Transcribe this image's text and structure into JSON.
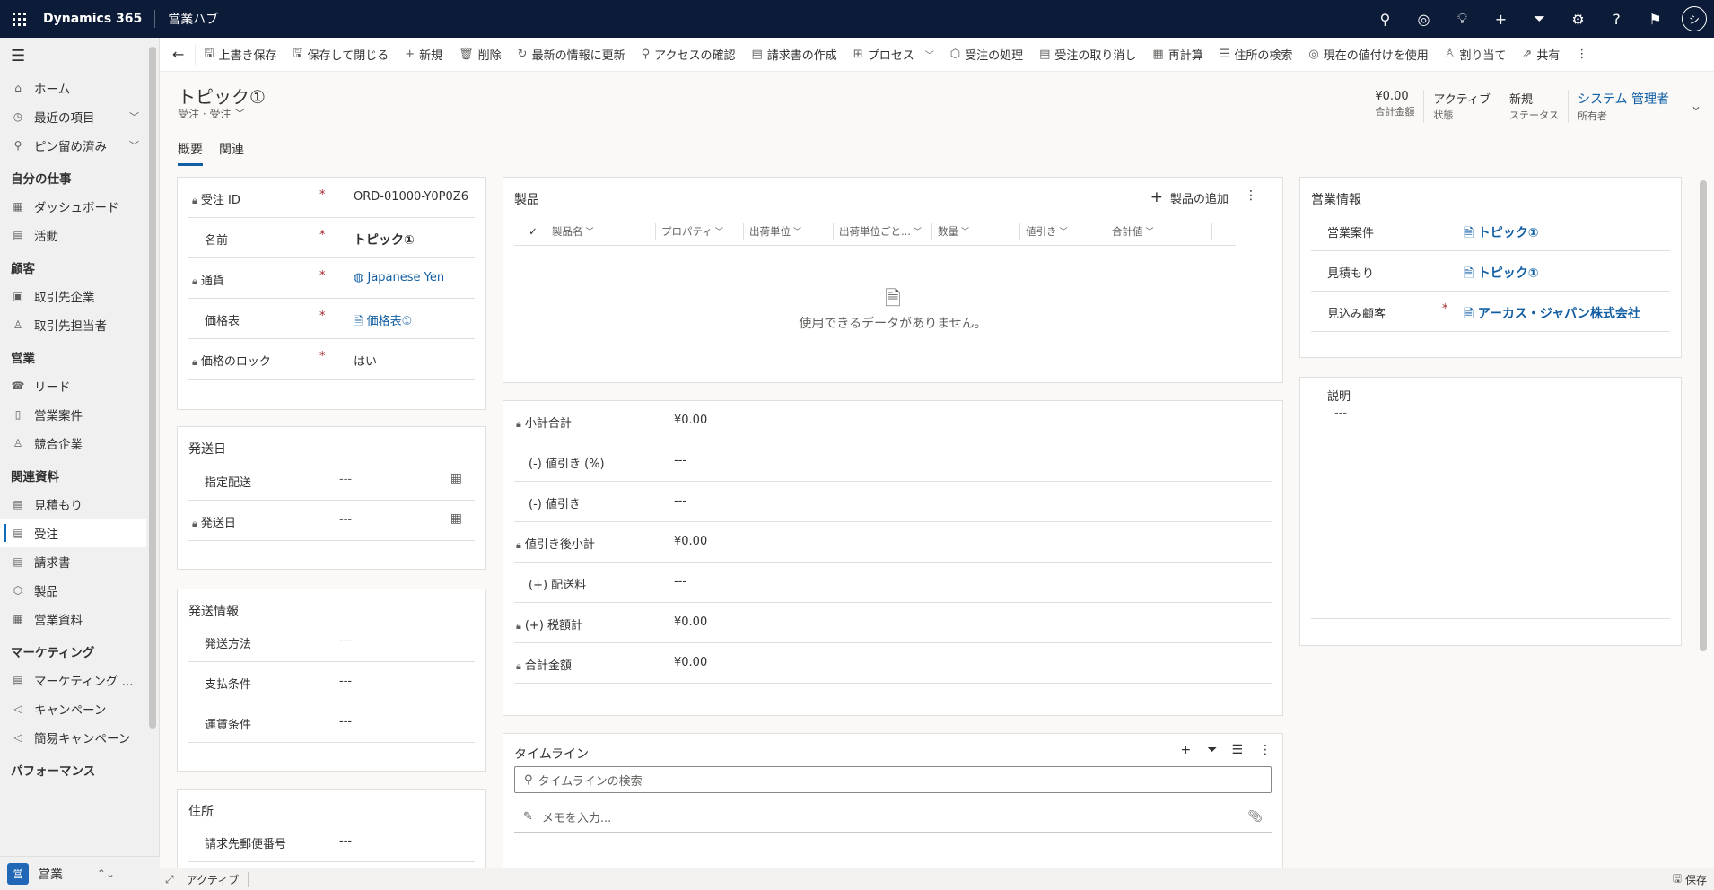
{
  "topbar": {
    "brand": "Dynamics 365",
    "hub": "営業ハブ",
    "icons": [
      "search-icon",
      "task-icon",
      "lightbulb-icon",
      "add-icon",
      "filter-icon",
      "settings-icon",
      "help-icon",
      "feedback-icon"
    ],
    "avatar": "シ"
  },
  "sidebar": {
    "items_top": [
      {
        "icon": "⌂",
        "label": "ホーム"
      },
      {
        "icon": "◷",
        "label": "最近の項目",
        "chev": "﹀"
      },
      {
        "icon": "⚲",
        "label": "ピン留め済み",
        "chev": "﹀"
      }
    ],
    "sections": [
      {
        "title": "自分の仕事",
        "items": [
          {
            "icon": "▦",
            "label": "ダッシュボード"
          },
          {
            "icon": "▤",
            "label": "活動"
          }
        ]
      },
      {
        "title": "顧客",
        "items": [
          {
            "icon": "▣",
            "label": "取引先企業"
          },
          {
            "icon": "♙",
            "label": "取引先担当者"
          }
        ]
      },
      {
        "title": "営業",
        "items": [
          {
            "icon": "☎",
            "label": "リード"
          },
          {
            "icon": "▯",
            "label": "営業案件"
          },
          {
            "icon": "♙",
            "label": "競合企業"
          }
        ]
      },
      {
        "title": "関連資料",
        "items": [
          {
            "icon": "▤",
            "label": "見積もり"
          },
          {
            "icon": "▤",
            "label": "受注"
          },
          {
            "icon": "▤",
            "label": "請求書"
          },
          {
            "icon": "⬡",
            "label": "製品"
          },
          {
            "icon": "▦",
            "label": "営業資料"
          }
        ]
      },
      {
        "title": "マーケティング",
        "items": [
          {
            "icon": "▤",
            "label": "マーケティング ..."
          },
          {
            "icon": "◁",
            "label": "キャンペーン"
          },
          {
            "icon": "◁",
            "label": "簡易キャンペーン"
          }
        ]
      },
      {
        "title": "パフォーマンス",
        "items": []
      }
    ],
    "area": {
      "badge": "営",
      "label": "営業",
      "chev": "⌃⌄"
    }
  },
  "commands": [
    {
      "icon": "🖫",
      "label": "上書き保存"
    },
    {
      "icon": "🖫",
      "label": "保存して閉じる"
    },
    {
      "icon": "+",
      "label": "新規"
    },
    {
      "icon": "🗑",
      "label": "削除"
    },
    {
      "icon": "↻",
      "label": "最新の情報に更新"
    },
    {
      "icon": "⚲",
      "label": "アクセスの確認"
    },
    {
      "icon": "▤",
      "label": "請求書の作成"
    },
    {
      "icon": "⊞",
      "label": "プロセス",
      "dd": "﹀"
    },
    {
      "icon": "⬡",
      "label": "受注の処理"
    },
    {
      "icon": "▤",
      "label": "受注の取り消し"
    },
    {
      "icon": "▦",
      "label": "再計算"
    },
    {
      "icon": "☰",
      "label": "住所の検索"
    },
    {
      "icon": "◎",
      "label": "現在の値付けを使用"
    },
    {
      "icon": "♙",
      "label": "割り当て"
    },
    {
      "icon": "⇗",
      "label": "共有"
    }
  ],
  "header": {
    "title": "トピック①",
    "subtitle": "受注 · 受注",
    "fields": [
      {
        "value": "¥0.00",
        "label": "合計金額"
      },
      {
        "value": "アクティブ",
        "label": "状態"
      },
      {
        "value": "新規",
        "label": "ステータス"
      },
      {
        "value": "システム 管理者",
        "label": "所有者"
      }
    ],
    "tabs": [
      "概要",
      "関連"
    ]
  },
  "general": {
    "rows": [
      {
        "label": "受注 ID",
        "lock": true,
        "req": "*",
        "value": "ORD-01000-Y0P0Z6"
      },
      {
        "label": "名前",
        "lock": false,
        "req": "*",
        "value": "トピック①"
      },
      {
        "label": "通貨",
        "lock": true,
        "req": "*",
        "value": "Japanese Yen"
      },
      {
        "label": "価格表",
        "lock": false,
        "req": "*",
        "value": "価格表①"
      },
      {
        "label": "価格のロック",
        "lock": true,
        "req": "*",
        "value": "はい"
      }
    ]
  },
  "shipdate": {
    "title": "発送日",
    "rows": [
      {
        "label": "指定配送",
        "lock": false,
        "value": "---"
      },
      {
        "label": "発送日",
        "lock": true,
        "value": "---"
      }
    ]
  },
  "shipinfo": {
    "title": "発送情報",
    "rows": [
      {
        "label": "発送方法",
        "value": "---"
      },
      {
        "label": "支払条件",
        "value": "---"
      },
      {
        "label": "運賃条件",
        "value": "---"
      }
    ]
  },
  "address": {
    "title": "住所",
    "rows": [
      {
        "label": "請求先郵便番号",
        "value": "---"
      }
    ]
  },
  "products": {
    "title": "製品",
    "add_label": "製品の追加",
    "columns": [
      "製品名",
      "プロパティ",
      "出荷単位",
      "出荷単位ごと...",
      "数量",
      "値引き",
      "合計値"
    ],
    "empty": "使用できるデータがありません。"
  },
  "totals": {
    "rows": [
      {
        "label": "小計合計",
        "lock": true,
        "value": "¥0.00"
      },
      {
        "label": "(-) 値引き (%)",
        "lock": false,
        "value": "---"
      },
      {
        "label": "(-) 値引き",
        "lock": false,
        "value": "---"
      },
      {
        "label": "値引き後小計",
        "lock": true,
        "value": "¥0.00"
      },
      {
        "label": "(+) 配送料",
        "lock": false,
        "value": "---"
      },
      {
        "label": "(+) 税額計",
        "lock": true,
        "value": "¥0.00"
      },
      {
        "label": "合計金額",
        "lock": true,
        "value": "¥0.00"
      }
    ]
  },
  "timeline": {
    "title": "タイムライン",
    "search_placeholder": "タイムラインの検索",
    "note_placeholder": "メモを入力..."
  },
  "sales": {
    "title": "営業情報",
    "rows": [
      {
        "label": "営業案件",
        "req": "",
        "value": "トピック①"
      },
      {
        "label": "見積もり",
        "req": "",
        "value": "トピック①"
      },
      {
        "label": "見込み顧客",
        "req": "*",
        "value": "アーカス・ジャパン株式会社"
      }
    ]
  },
  "description": {
    "label": "説明",
    "value": "---"
  },
  "status": {
    "state": "アクティブ",
    "save": "保存"
  }
}
